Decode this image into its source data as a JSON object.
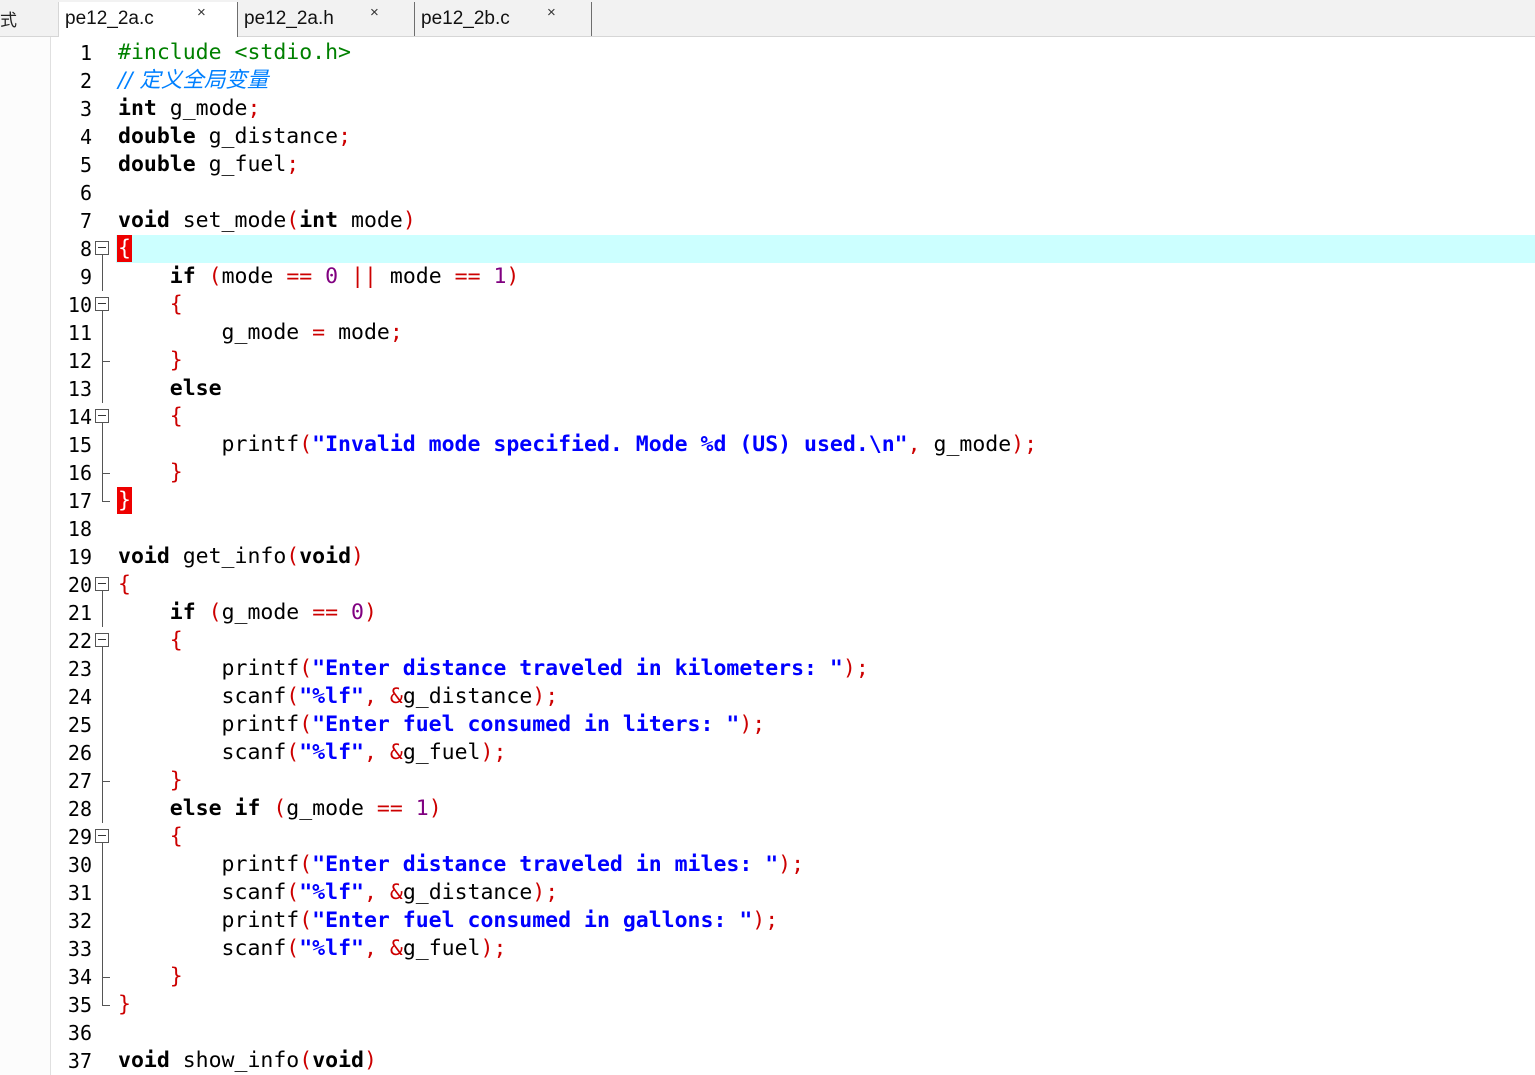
{
  "sidebar": {
    "label": "式"
  },
  "tabs": [
    {
      "label": "pe12_2a.c",
      "close": "×",
      "active": true
    },
    {
      "label": "pe12_2a.h",
      "close": "×",
      "active": false
    },
    {
      "label": "pe12_2b.c",
      "close": "×",
      "active": false
    }
  ],
  "editor": {
    "current_line": 8,
    "lines": [
      {
        "n": "1",
        "fold": "",
        "tokens": [
          [
            "pp",
            "#include <stdio.h>"
          ]
        ]
      },
      {
        "n": "2",
        "fold": "",
        "tokens": [
          [
            "cm",
            "// 定义全局变量"
          ]
        ]
      },
      {
        "n": "3",
        "fold": "",
        "tokens": [
          [
            "kw",
            "int"
          ],
          [
            "",
            " g_mode"
          ],
          [
            "op",
            ";"
          ]
        ]
      },
      {
        "n": "4",
        "fold": "",
        "tokens": [
          [
            "kw",
            "double"
          ],
          [
            "",
            " g_distance"
          ],
          [
            "op",
            ";"
          ]
        ]
      },
      {
        "n": "5",
        "fold": "",
        "tokens": [
          [
            "kw",
            "double"
          ],
          [
            "",
            " g_fuel"
          ],
          [
            "op",
            ";"
          ]
        ]
      },
      {
        "n": "6",
        "fold": "",
        "tokens": []
      },
      {
        "n": "7",
        "fold": "",
        "tokens": [
          [
            "kw",
            "void"
          ],
          [
            "",
            " set_mode"
          ],
          [
            "op",
            "("
          ],
          [
            "kw",
            "int"
          ],
          [
            "",
            " mode"
          ],
          [
            "op",
            ")"
          ]
        ]
      },
      {
        "n": "8",
        "fold": "start",
        "tokens": [
          [
            "brace-hl",
            "{"
          ]
        ]
      },
      {
        "n": "9",
        "fold": "mid",
        "tokens": [
          [
            "",
            "    "
          ],
          [
            "kw",
            "if"
          ],
          [
            "",
            " "
          ],
          [
            "op",
            "("
          ],
          [
            "",
            "mode "
          ],
          [
            "op",
            "=="
          ],
          [
            "",
            " "
          ],
          [
            "num",
            "0"
          ],
          [
            "",
            " "
          ],
          [
            "op",
            "||"
          ],
          [
            "",
            " mode "
          ],
          [
            "op",
            "=="
          ],
          [
            "",
            " "
          ],
          [
            "num",
            "1"
          ],
          [
            "op",
            ")"
          ]
        ]
      },
      {
        "n": "10",
        "fold": "start",
        "tokens": [
          [
            "",
            "    "
          ],
          [
            "op",
            "{"
          ]
        ]
      },
      {
        "n": "11",
        "fold": "mid",
        "tokens": [
          [
            "",
            "        g_mode "
          ],
          [
            "op",
            "="
          ],
          [
            "",
            " mode"
          ],
          [
            "op",
            ";"
          ]
        ]
      },
      {
        "n": "12",
        "fold": "end",
        "tokens": [
          [
            "",
            "    "
          ],
          [
            "op",
            "}"
          ]
        ]
      },
      {
        "n": "13",
        "fold": "mid",
        "tokens": [
          [
            "",
            "    "
          ],
          [
            "kw",
            "else"
          ]
        ]
      },
      {
        "n": "14",
        "fold": "start",
        "tokens": [
          [
            "",
            "    "
          ],
          [
            "op",
            "{"
          ]
        ]
      },
      {
        "n": "15",
        "fold": "mid",
        "tokens": [
          [
            "",
            "        printf"
          ],
          [
            "op",
            "("
          ],
          [
            "str",
            "\"Invalid mode specified. Mode %d (US) used.\\n\""
          ],
          [
            "op",
            ","
          ],
          [
            "",
            " g_mode"
          ],
          [
            "op",
            ");"
          ]
        ]
      },
      {
        "n": "16",
        "fold": "end",
        "tokens": [
          [
            "",
            "    "
          ],
          [
            "op",
            "}"
          ]
        ]
      },
      {
        "n": "17",
        "fold": "lastend",
        "tokens": [
          [
            "brace-hl",
            "}"
          ]
        ]
      },
      {
        "n": "18",
        "fold": "",
        "tokens": []
      },
      {
        "n": "19",
        "fold": "",
        "tokens": [
          [
            "kw",
            "void"
          ],
          [
            "",
            " get_info"
          ],
          [
            "op",
            "("
          ],
          [
            "kw",
            "void"
          ],
          [
            "op",
            ")"
          ]
        ]
      },
      {
        "n": "20",
        "fold": "start",
        "tokens": [
          [
            "op",
            "{"
          ]
        ]
      },
      {
        "n": "21",
        "fold": "mid",
        "tokens": [
          [
            "",
            "    "
          ],
          [
            "kw",
            "if"
          ],
          [
            "",
            " "
          ],
          [
            "op",
            "("
          ],
          [
            "",
            "g_mode "
          ],
          [
            "op",
            "=="
          ],
          [
            "",
            " "
          ],
          [
            "num",
            "0"
          ],
          [
            "op",
            ")"
          ]
        ]
      },
      {
        "n": "22",
        "fold": "start",
        "tokens": [
          [
            "",
            "    "
          ],
          [
            "op",
            "{"
          ]
        ]
      },
      {
        "n": "23",
        "fold": "mid",
        "tokens": [
          [
            "",
            "        printf"
          ],
          [
            "op",
            "("
          ],
          [
            "str",
            "\"Enter distance traveled in kilometers: \""
          ],
          [
            "op",
            ");"
          ]
        ]
      },
      {
        "n": "24",
        "fold": "mid",
        "tokens": [
          [
            "",
            "        scanf"
          ],
          [
            "op",
            "("
          ],
          [
            "str",
            "\"%lf\""
          ],
          [
            "op",
            ","
          ],
          [
            "",
            " "
          ],
          [
            "op",
            "&"
          ],
          [
            "",
            "g_distance"
          ],
          [
            "op",
            ");"
          ]
        ]
      },
      {
        "n": "25",
        "fold": "mid",
        "tokens": [
          [
            "",
            "        printf"
          ],
          [
            "op",
            "("
          ],
          [
            "str",
            "\"Enter fuel consumed in liters: \""
          ],
          [
            "op",
            ");"
          ]
        ]
      },
      {
        "n": "26",
        "fold": "mid",
        "tokens": [
          [
            "",
            "        scanf"
          ],
          [
            "op",
            "("
          ],
          [
            "str",
            "\"%lf\""
          ],
          [
            "op",
            ","
          ],
          [
            "",
            " "
          ],
          [
            "op",
            "&"
          ],
          [
            "",
            "g_fuel"
          ],
          [
            "op",
            ");"
          ]
        ]
      },
      {
        "n": "27",
        "fold": "end",
        "tokens": [
          [
            "",
            "    "
          ],
          [
            "op",
            "}"
          ]
        ]
      },
      {
        "n": "28",
        "fold": "mid",
        "tokens": [
          [
            "",
            "    "
          ],
          [
            "kw",
            "else if"
          ],
          [
            "",
            " "
          ],
          [
            "op",
            "("
          ],
          [
            "",
            "g_mode "
          ],
          [
            "op",
            "=="
          ],
          [
            "",
            " "
          ],
          [
            "num",
            "1"
          ],
          [
            "op",
            ")"
          ]
        ]
      },
      {
        "n": "29",
        "fold": "start",
        "tokens": [
          [
            "",
            "    "
          ],
          [
            "op",
            "{"
          ]
        ]
      },
      {
        "n": "30",
        "fold": "mid",
        "tokens": [
          [
            "",
            "        printf"
          ],
          [
            "op",
            "("
          ],
          [
            "str",
            "\"Enter distance traveled in miles: \""
          ],
          [
            "op",
            ");"
          ]
        ]
      },
      {
        "n": "31",
        "fold": "mid",
        "tokens": [
          [
            "",
            "        scanf"
          ],
          [
            "op",
            "("
          ],
          [
            "str",
            "\"%lf\""
          ],
          [
            "op",
            ","
          ],
          [
            "",
            " "
          ],
          [
            "op",
            "&"
          ],
          [
            "",
            "g_distance"
          ],
          [
            "op",
            ");"
          ]
        ]
      },
      {
        "n": "32",
        "fold": "mid",
        "tokens": [
          [
            "",
            "        printf"
          ],
          [
            "op",
            "("
          ],
          [
            "str",
            "\"Enter fuel consumed in gallons: \""
          ],
          [
            "op",
            ");"
          ]
        ]
      },
      {
        "n": "33",
        "fold": "mid",
        "tokens": [
          [
            "",
            "        scanf"
          ],
          [
            "op",
            "("
          ],
          [
            "str",
            "\"%lf\""
          ],
          [
            "op",
            ","
          ],
          [
            "",
            " "
          ],
          [
            "op",
            "&"
          ],
          [
            "",
            "g_fuel"
          ],
          [
            "op",
            ");"
          ]
        ]
      },
      {
        "n": "34",
        "fold": "end",
        "tokens": [
          [
            "",
            "    "
          ],
          [
            "op",
            "}"
          ]
        ]
      },
      {
        "n": "35",
        "fold": "lastend",
        "tokens": [
          [
            "op",
            "}"
          ]
        ]
      },
      {
        "n": "36",
        "fold": "",
        "tokens": []
      },
      {
        "n": "37",
        "fold": "",
        "tokens": [
          [
            "kw",
            "void"
          ],
          [
            "",
            " show_info"
          ],
          [
            "op",
            "("
          ],
          [
            "kw",
            "void"
          ],
          [
            "op",
            ")"
          ]
        ]
      }
    ]
  }
}
